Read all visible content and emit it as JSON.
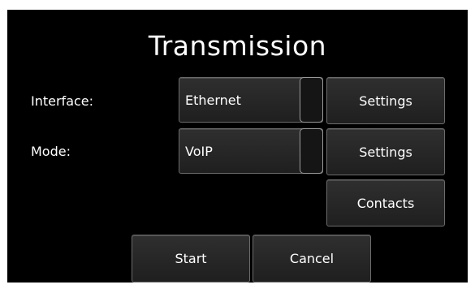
{
  "dialog": {
    "title": "Transmission"
  },
  "interface": {
    "label": "Interface:",
    "selected_value": "Ethernet",
    "settings_label": "Settings"
  },
  "mode": {
    "label": "Mode:",
    "selected_value": "VoIP",
    "settings_label": "Settings"
  },
  "contacts": {
    "label": "Contacts"
  },
  "footer": {
    "start_label": "Start",
    "cancel_label": "Cancel"
  },
  "colors": {
    "background": "#000000",
    "button_fill": "#262626",
    "button_border": "#6c6c6c",
    "text": "#ffffff"
  }
}
